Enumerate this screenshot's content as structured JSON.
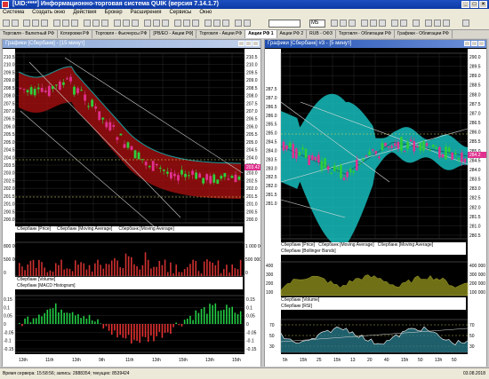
{
  "window": {
    "title": "[UID:****] Информационно-торговая система QUIK (версия 7.14.1.7)"
  },
  "menu": [
    "Система",
    "Создать окно",
    "Действия",
    "Брокер",
    "Расширения",
    "Сервисы",
    "Окно"
  ],
  "toolbar": {
    "interval_value": "M5",
    "ticker_value": ""
  },
  "tabs": [
    {
      "label": "Торговля - Валютный РФ"
    },
    {
      "label": "Котировки РФ"
    },
    {
      "label": "Торговля - Фьючерсы РФ"
    },
    {
      "label": "[РВ/ЕО - Акции РФ]"
    },
    {
      "label": "Торговля - Акции РФ"
    },
    {
      "label": "Акции РФ 1",
      "active": true
    },
    {
      "label": "Акции РФ 2"
    },
    {
      "label": "RUB - ОФЗ"
    },
    {
      "label": "Торговля - Облигации РФ"
    },
    {
      "label": "Графики - Облигации РФ"
    }
  ],
  "left_window": {
    "title": "Графики [Сбербанк] - [15 минут]",
    "price_legend": [
      "Сбербанк [Price]",
      "Сбербанк [Moving Average]",
      "Сбербанк [Moving Average]"
    ],
    "volume_legend": "Сбербанк [Volume]",
    "macd_legend": "Сбербанк [MACD Histogram]",
    "time_labels": [
      "13th",
      "11th",
      "13th",
      "9th",
      "11th",
      "13th",
      "15th",
      "13th",
      "15th"
    ],
    "price_ticks": [
      "210.5",
      "210.0",
      "209.5",
      "209.0",
      "208.5",
      "208.0",
      "207.5",
      "207.0",
      "206.5",
      "206.0",
      "205.5",
      "205.0",
      "204.5",
      "204.0",
      "203.5",
      "203.0",
      "202.5",
      "202.0",
      "201.5",
      "201.0",
      "200.5",
      "200.0"
    ],
    "right_price_ticks": [
      "210.5",
      "210.0",
      "209.5",
      "209.0",
      "208.5",
      "208.0",
      "207.5",
      "207.0",
      "206.5",
      "206.0",
      "205.5",
      "205.0",
      "204.5",
      "204.0",
      "203.5",
      "203.0",
      "202.5",
      "202.0",
      "201.5",
      "201.0",
      "200.5",
      "200.0"
    ],
    "last_price": "203.42",
    "volume_ticks": [
      "800 000",
      "500 000",
      "0"
    ],
    "volume_ticks_right": [
      "1 000 000",
      "500 000",
      "0"
    ],
    "macd_ticks": [
      "0.15",
      "0.1",
      "0.05",
      "0",
      "-0.05",
      "-0.1",
      "-0.15"
    ]
  },
  "right_window": {
    "title": "Графики [Сбербанк] #3 - [5 минут]",
    "price_legend": [
      "Сбербанк [Price]",
      "Сбербанк [Moving Average]",
      "Сбербанк [Moving Average]",
      "Сбербанк [Bollinger Bands]"
    ],
    "volume_legend": "Сбербанк [Volume]",
    "rsi_legend": "Сбербанк [RSI]",
    "time_labels": [
      "5h",
      "15h",
      "25",
      "15h",
      "13",
      "20",
      "40",
      "15h",
      "50",
      "13h",
      "50"
    ],
    "price_ticks": [
      "290.0",
      "289.5",
      "289.0",
      "288.5",
      "288.0",
      "287.5",
      "287.0",
      "286.5",
      "286.0",
      "285.5",
      "285.0",
      "284.5",
      "284.0",
      "283.5",
      "283.0",
      "282.5",
      "282.0",
      "281.5",
      "281.0",
      "280.5"
    ],
    "left_price_ticks": [
      "287.5",
      "287.0",
      "286.5",
      "286.0",
      "285.5",
      "285.0",
      "284.5",
      "284.0",
      "283.5",
      "283.0",
      "282.5",
      "282.0",
      "281.5",
      "281.0"
    ],
    "last_price": "284.2",
    "volume_ticks": [
      "400 000",
      "300 000",
      "200 000",
      "100 000"
    ],
    "rsi_ticks": [
      "70",
      "50",
      "30"
    ]
  },
  "status": {
    "text": "Время сервера: 15:58:56; запись: 2888354; текущих: 8539424",
    "date": "03.08.2018"
  },
  "colors": {
    "candle_up": "#2ecf3a",
    "candle_down": "#e0318f",
    "ma_cloud_left": "#b01010",
    "bollinger_fill": "#18c8c8",
    "volume_bar": "#d03030",
    "macd_pos": "#22cc44",
    "macd_neg": "#e03030",
    "rsi_line": "#ffffff"
  }
}
